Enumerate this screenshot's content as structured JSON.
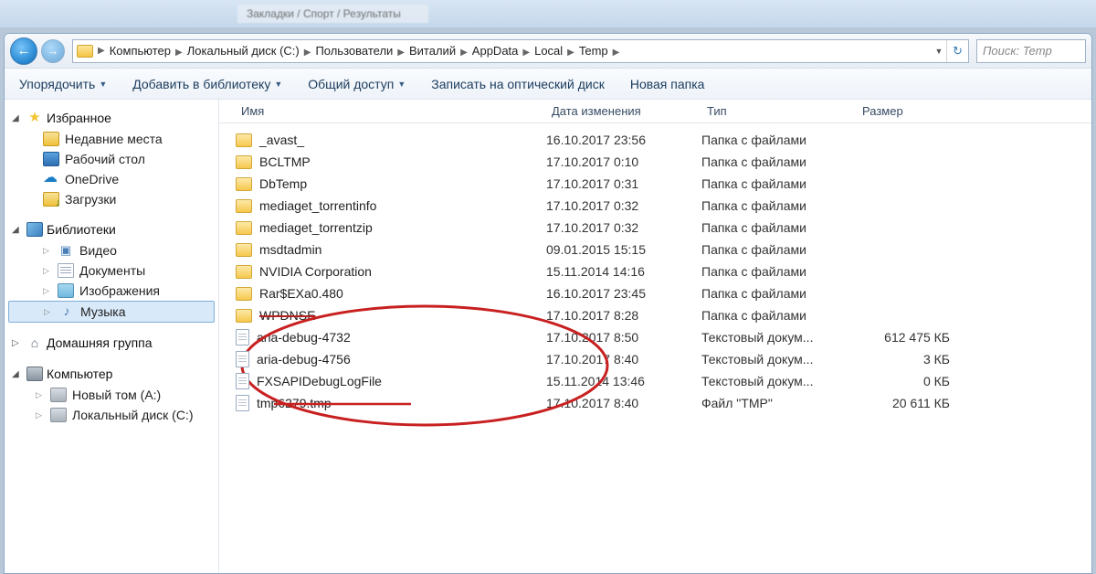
{
  "titlebar": {
    "tab": "Закладки / Спорт / Результаты"
  },
  "breadcrumb": [
    "Компьютер",
    "Локальный диск (C:)",
    "Пользователи",
    "Виталий",
    "AppData",
    "Local",
    "Temp"
  ],
  "search": {
    "placeholder": "Поиск: Temp"
  },
  "toolbar": {
    "organize": "Упорядочить",
    "add_to_library": "Добавить в библиотеку",
    "share": "Общий доступ",
    "burn": "Записать на оптический диск",
    "new_folder": "Новая папка"
  },
  "sidebar": {
    "favorites": {
      "label": "Избранное",
      "items": [
        "Недавние места",
        "Рабочий стол",
        "OneDrive",
        "Загрузки"
      ]
    },
    "libraries": {
      "label": "Библиотеки",
      "items": [
        "Видео",
        "Документы",
        "Изображения",
        "Музыка"
      ]
    },
    "homegroup": {
      "label": "Домашняя группа"
    },
    "computer": {
      "label": "Компьютер",
      "items": [
        "Новый том (A:)",
        "Локальный диск (C:)"
      ]
    }
  },
  "columns": {
    "name": "Имя",
    "date": "Дата изменения",
    "type": "Тип",
    "size": "Размер"
  },
  "files": [
    {
      "icon": "folder",
      "name": "_avast_",
      "date": "16.10.2017 23:56",
      "type": "Папка с файлами",
      "size": ""
    },
    {
      "icon": "folder",
      "name": "BCLTMP",
      "date": "17.10.2017 0:10",
      "type": "Папка с файлами",
      "size": ""
    },
    {
      "icon": "folder",
      "name": "DbTemp",
      "date": "17.10.2017 0:31",
      "type": "Папка с файлами",
      "size": ""
    },
    {
      "icon": "folder",
      "name": "mediaget_torrentinfo",
      "date": "17.10.2017 0:32",
      "type": "Папка с файлами",
      "size": ""
    },
    {
      "icon": "folder",
      "name": "mediaget_torrentzip",
      "date": "17.10.2017 0:32",
      "type": "Папка с файлами",
      "size": ""
    },
    {
      "icon": "folder",
      "name": "msdtadmin",
      "date": "09.01.2015 15:15",
      "type": "Папка с файлами",
      "size": ""
    },
    {
      "icon": "folder",
      "name": "NVIDIA Corporation",
      "date": "15.11.2014 14:16",
      "type": "Папка с файлами",
      "size": ""
    },
    {
      "icon": "folder",
      "name": "Rar$EXa0.480",
      "date": "16.10.2017 23:45",
      "type": "Папка с файлами",
      "size": ""
    },
    {
      "icon": "folder",
      "name": "WPDNSE",
      "date": "17.10.2017 8:28",
      "type": "Папка с файлами",
      "size": "",
      "strike": true
    },
    {
      "icon": "file",
      "name": "aria-debug-4732",
      "date": "17.10.2017 8:50",
      "type": "Текстовый докум...",
      "size": "612 475 КБ"
    },
    {
      "icon": "file",
      "name": "aria-debug-4756",
      "date": "17.10.2017 8:40",
      "type": "Текстовый докум...",
      "size": "3 КБ"
    },
    {
      "icon": "file",
      "name": "FXSAPIDebugLogFile",
      "date": "15.11.2014 13:46",
      "type": "Текстовый докум...",
      "size": "0 КБ"
    },
    {
      "icon": "file",
      "name": "tmp6279.tmp",
      "date": "17.10.2017 8:40",
      "type": "Файл \"TMP\"",
      "size": "20 611 КБ"
    }
  ]
}
